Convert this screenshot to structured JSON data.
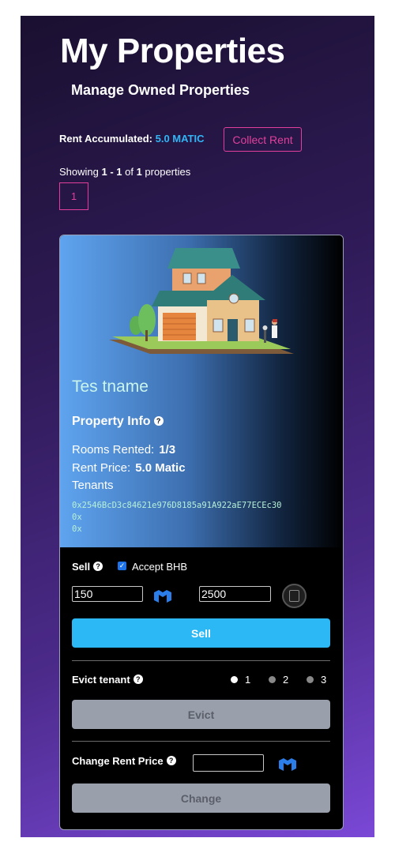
{
  "header": {
    "title": "My Properties",
    "subtitle": "Manage Owned Properties"
  },
  "rent": {
    "label": "Rent Accumulated:",
    "value": "5.0 MATIC",
    "collect_label": "Collect Rent"
  },
  "pagination": {
    "prefix": "Showing ",
    "range": "1 - 1",
    "of": " of ",
    "total": "1",
    "suffix": " properties",
    "current_page": "1"
  },
  "property": {
    "name": "Tes tname",
    "info_title": "Property Info",
    "rooms_label": "Rooms Rented:",
    "rooms_value": "1/3",
    "price_label": "Rent Price:",
    "price_value": "5.0 Matic",
    "tenants_label": "Tenants",
    "tenants": [
      "0x2546BcD3c84621e976D8185a91A922aE77ECEc30",
      "0x",
      "0x"
    ]
  },
  "sell": {
    "label": "Sell",
    "accept_label": "Accept",
    "accept_token": "BHB",
    "accept_checked": true,
    "matic_price": "150",
    "bhb_price": "2500",
    "button": "Sell"
  },
  "evict": {
    "label": "Evict tenant",
    "options": [
      "1",
      "2",
      "3"
    ],
    "selected": "1",
    "button": "Evict"
  },
  "change_rent": {
    "label": "Change Rent Price",
    "value": "",
    "button": "Change"
  },
  "icons": {
    "help": "help-icon",
    "matic": "matic-icon",
    "bhb": "bhb-coin-icon"
  },
  "colors": {
    "accent": "#e0409b",
    "primary_button": "#2bb8f5",
    "disabled_button": "#9aa0ab",
    "matic_blue": "#33b5f5"
  }
}
